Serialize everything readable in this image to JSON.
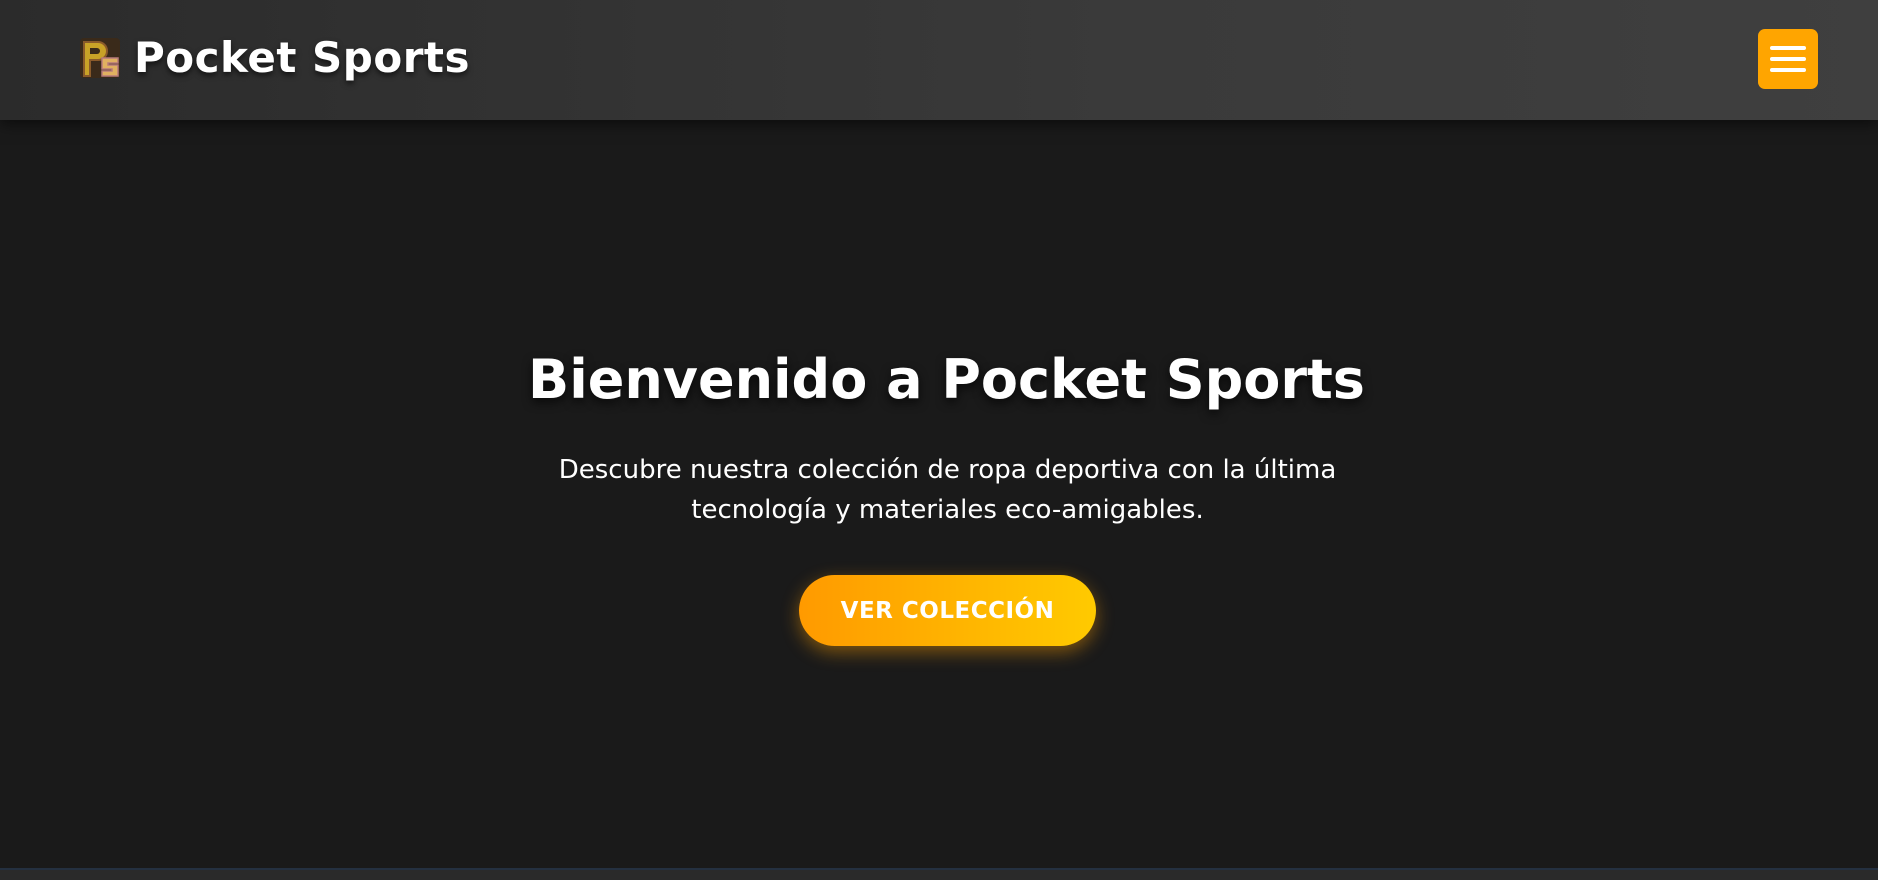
{
  "header": {
    "brand_name": "Pocket Sports",
    "logo_icon": "pocket-sports-logo-icon",
    "menu_icon": "hamburger-menu-icon"
  },
  "hero": {
    "title": "Bienvenido a Pocket Sports",
    "description": "Descubre nuestra colección de ropa deportiva con la última tecnología y materiales eco-amigables.",
    "cta_label": "VER COLECCIÓN"
  },
  "colors": {
    "accent": "#ffa500",
    "accent_end": "#ffca00",
    "header_bg": "#333333",
    "page_bg": "#1a1a1a",
    "text": "#ffffff"
  }
}
